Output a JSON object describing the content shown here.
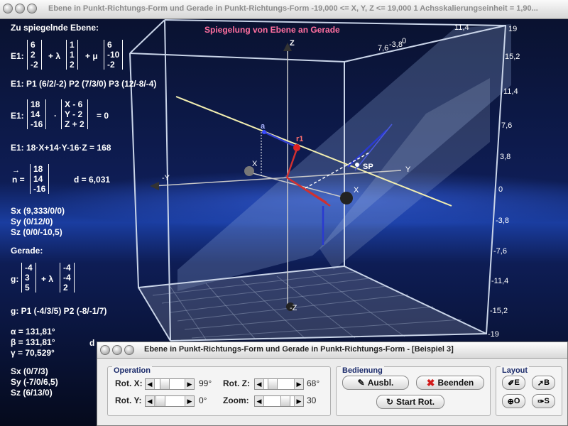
{
  "window": {
    "title": "Ebene in Punkt-Richtungs-Form und Gerade in Punkt-Richtungs-Form   -19,000 <= X, Y, Z <= 19,000   1 Achsskalierungseinheit = 1,90..."
  },
  "scene": {
    "heading": "Spiegelung von Ebene an Gerade",
    "axis_labels": {
      "z_pos": "Z",
      "z_neg": "-Z",
      "y_pos": "Y",
      "y_neg": "-Y",
      "x_pos": "X",
      "x_neg": "X"
    },
    "point_labels": {
      "a": "a",
      "r1": "r1",
      "sp": "SP"
    },
    "scale_values": [
      "19",
      "15,2",
      "11,4",
      "7,6",
      "3,8",
      "0",
      "-3,8",
      "-7,6",
      "-11,4",
      "-15,2",
      "-19"
    ],
    "top_tick_labels": [
      "11,4",
      "7,6",
      "-3,8",
      "0"
    ]
  },
  "left_panel": {
    "plane_heading": "Zu spiegelnde Ebene:",
    "e1_label": "E1:",
    "e1_vec1": [
      "6",
      "2",
      "-2"
    ],
    "e1_vec2": [
      "1",
      "1",
      "2"
    ],
    "e1_vec3": [
      "6",
      "-10",
      "-2"
    ],
    "plus_lambda": "+ λ",
    "plus_mu": "+ μ",
    "e1_points": "E1: P1 (6/2/-2)   P2 (7/3/0)   P3 (12/-8/-4)",
    "e1_normal_vec": [
      "18",
      "14",
      "-16"
    ],
    "e1_xyz_vec": [
      "X - 6",
      "Y - 2",
      "Z + 2"
    ],
    "dot": "·",
    "eq_zero": "= 0",
    "e1_coord": "E1: 18·X+14·Y-16·Z = 168",
    "arrow": "→",
    "n_label": "n =",
    "n_vec": [
      "18",
      "14",
      "-16"
    ],
    "d_label": "d = 6,031",
    "sx": "Sx (9,333/0/0)",
    "sy": "Sy (0/12/0)",
    "sz": "Sz (0/0/-10,5)",
    "line_heading": "Gerade:",
    "g_label": "g:",
    "g_vec1": [
      "-4",
      "3",
      "5"
    ],
    "g_vec2": [
      "-4",
      "-4",
      "2"
    ],
    "g_points": "g: P1 (-4/3/5)   P2 (-8/-1/7)",
    "alpha": "α = 131,81°",
    "beta": "β = 131,81°",
    "gamma": "γ = 70,529°",
    "d_short": "d",
    "sx2": "Sx (0/7/3)",
    "sy2": "Sy (-7/0/6,5)",
    "sz2": "Sz (6/13/0)"
  },
  "dialog": {
    "title": "Ebene in Punkt-Richtungs-Form und Gerade in Punkt-Richtungs-Form - [Beispiel 3]",
    "operation_label": "Operation",
    "rot_x_label": "Rot. X:",
    "rot_x_value": "99°",
    "rot_y_label": "Rot. Y:",
    "rot_y_value": "0°",
    "rot_z_label": "Rot. Z:",
    "rot_z_value": "68°",
    "zoom_label": "Zoom:",
    "zoom_value": "30",
    "bedienung_label": "Bedienung",
    "ausbl_label": "Ausbl.",
    "beenden_label": "Beenden",
    "start_rot_label": "Start Rot.",
    "layout_label": "Layout",
    "layout_e": "E",
    "layout_b": "B",
    "layout_o": "O",
    "layout_s": "S"
  }
}
